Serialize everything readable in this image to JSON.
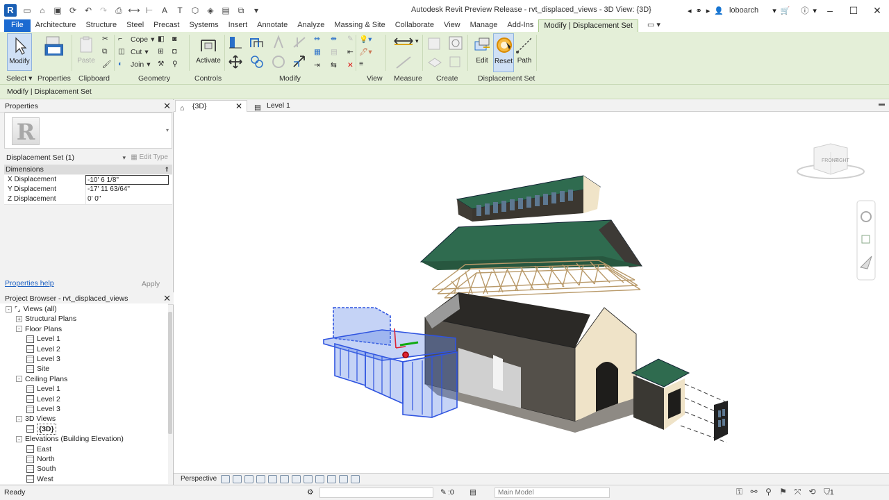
{
  "app": {
    "logo_letter": "R",
    "window_title": "Autodesk Revit Preview Release - rvt_displaced_views - 3D View: {3D}",
    "user": "loboarch"
  },
  "ribbon_tabs": [
    "File",
    "Architecture",
    "Structure",
    "Steel",
    "Precast",
    "Systems",
    "Insert",
    "Annotate",
    "Analyze",
    "Massing & Site",
    "Collaborate",
    "View",
    "Manage",
    "Add-Ins",
    "Modify | Displacement Set"
  ],
  "ribbon": {
    "modify_label": "Modify",
    "paste_label": "Paste",
    "cope_label": "Cope",
    "cut_label": "Cut",
    "join_label": "Join",
    "activate_label": "Activate",
    "edit_label": "Edit",
    "reset_label": "Reset",
    "path_label": "Path",
    "panels": {
      "select": "Select",
      "properties": "Properties",
      "clipboard": "Clipboard",
      "geometry": "Geometry",
      "controls": "Controls",
      "modify": "Modify",
      "view": "View",
      "measure": "Measure",
      "create": "Create",
      "displacement_set": "Displacement Set"
    }
  },
  "context_bar": "Modify | Displacement Set",
  "properties": {
    "title": "Properties",
    "type_selector": "Displacement Set (1)",
    "edit_type": "Edit Type",
    "group": "Dimensions",
    "rows": [
      {
        "label": "X Displacement",
        "value": "-10'  6 1/8\""
      },
      {
        "label": "Y Displacement",
        "value": "-17'  11 63/64\""
      },
      {
        "label": "Z Displacement",
        "value": "0'  0\""
      }
    ],
    "help": "Properties help",
    "apply": "Apply"
  },
  "project_browser": {
    "title": "Project Browser - rvt_displaced_views",
    "items": [
      {
        "label": "Views (all)",
        "level": 0,
        "toggle": "-",
        "kind": "root"
      },
      {
        "label": "Structural Plans",
        "level": 1,
        "toggle": "+",
        "kind": "group"
      },
      {
        "label": "Floor Plans",
        "level": 1,
        "toggle": "-",
        "kind": "group"
      },
      {
        "label": "Level 1",
        "level": 2,
        "kind": "view"
      },
      {
        "label": "Level 2",
        "level": 2,
        "kind": "view"
      },
      {
        "label": "Level 3",
        "level": 2,
        "kind": "view"
      },
      {
        "label": "Site",
        "level": 2,
        "kind": "view"
      },
      {
        "label": "Ceiling Plans",
        "level": 1,
        "toggle": "-",
        "kind": "group"
      },
      {
        "label": "Level 1",
        "level": 2,
        "kind": "view"
      },
      {
        "label": "Level 2",
        "level": 2,
        "kind": "view"
      },
      {
        "label": "Level 3",
        "level": 2,
        "kind": "view"
      },
      {
        "label": "3D Views",
        "level": 1,
        "toggle": "-",
        "kind": "group"
      },
      {
        "label": "{3D}",
        "level": 2,
        "kind": "view",
        "selected": true
      },
      {
        "label": "Elevations (Building Elevation)",
        "level": 1,
        "toggle": "-",
        "kind": "group"
      },
      {
        "label": "East",
        "level": 2,
        "kind": "view"
      },
      {
        "label": "North",
        "level": 2,
        "kind": "view"
      },
      {
        "label": "South",
        "level": 2,
        "kind": "view"
      },
      {
        "label": "West",
        "level": 2,
        "kind": "view"
      }
    ]
  },
  "view_tabs": [
    "{3D}",
    "Level 1"
  ],
  "viewcube": {
    "front": "FRONT",
    "right": "RIGHT"
  },
  "view_bar": {
    "mode": "Perspective"
  },
  "status_bar": {
    "status": "Ready",
    "coord": ":0",
    "model": "Main Model",
    "filter_count": ":1"
  },
  "colors": {
    "ribbon_bg": "#e4efd8",
    "file_tab": "#1b6ad1",
    "roof_green": "#2f6b4f",
    "wall_dark": "#54504a",
    "wall_cream": "#efe3c8",
    "selection_blue": "#2f54e0"
  }
}
